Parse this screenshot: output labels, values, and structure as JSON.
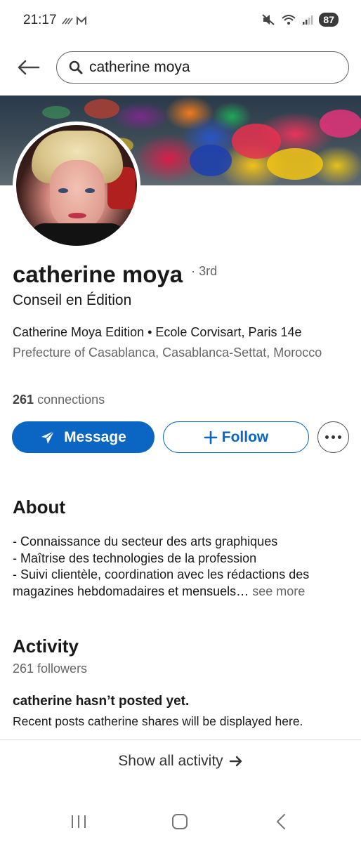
{
  "status": {
    "time": "21:17",
    "battery": "87"
  },
  "search": {
    "query": "catherine moya"
  },
  "profile": {
    "name": "catherine moya",
    "degree": "· 3rd",
    "headline": "Conseil en Édition",
    "experience": "Catherine Moya Edition • Ecole Corvisart, Paris 14e",
    "location": "Prefecture of Casablanca, Casablanca-Settat, Morocco",
    "connections_count": "261",
    "connections_label": "connections"
  },
  "actions": {
    "message": "Message",
    "follow": "Follow"
  },
  "about": {
    "title": "About",
    "lines": [
      "- Connaissance du secteur des arts graphiques",
      "- Maîtrise des technologies de la profession",
      "- Suivi clientèle, coordination avec les rédactions des",
      "magazines hebdomadaires et mensuels…"
    ],
    "see_more": "see more"
  },
  "activity": {
    "title": "Activity",
    "followers": "261 followers",
    "empty_title": "catherine hasn’t posted yet.",
    "empty_subtitle": "Recent posts catherine shares will be displayed here.",
    "show_all": "Show all activity"
  },
  "colors": {
    "primary": "#0a66c2",
    "text": "#191919",
    "muted": "#666666"
  }
}
